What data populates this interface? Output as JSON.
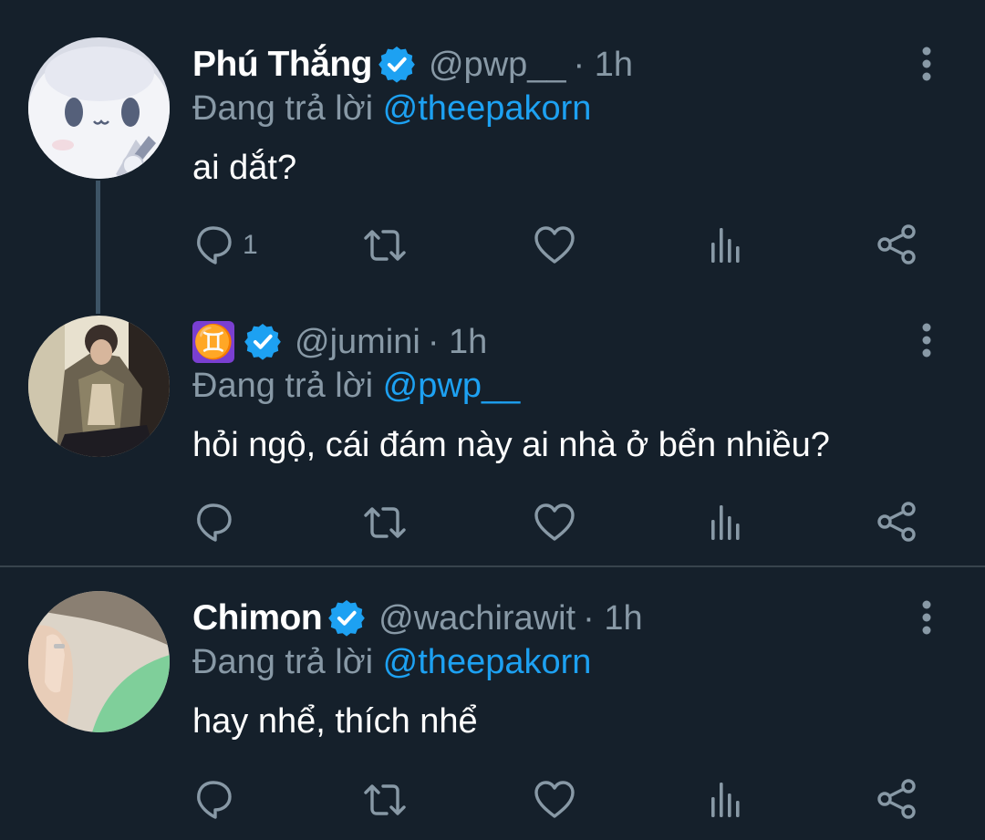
{
  "replying_label": "Đang trả lời",
  "tweets": [
    {
      "name": "Phú Thắng",
      "handle": "@pwp__",
      "time": "· 1h",
      "reply_to": "@theepakorn",
      "text": "ai dắt?",
      "reply_count": "1",
      "avatar_icon": "cartoon-avatar-icon"
    },
    {
      "name": "♊",
      "handle": "@jumini",
      "time": "· 1h",
      "reply_to": "@pwp__",
      "text": "hỏi ngộ, cái đám này ai nhà ở bển nhiều?",
      "reply_count": "",
      "avatar_icon": "photo-avatar-icon"
    },
    {
      "name": "Chimon",
      "handle": "@wachirawit",
      "time": "· 1h",
      "reply_to": "@theepakorn",
      "text": "hay nhể, thích nhể",
      "reply_count": "",
      "avatar_icon": "photo-avatar-icon"
    }
  ],
  "colors": {
    "background": "#15202b",
    "secondary_text": "#8899a6",
    "accent": "#1da1f2",
    "divider": "#38444d"
  },
  "icons": [
    "reply-icon",
    "retweet-icon",
    "like-icon",
    "analytics-icon",
    "share-icon",
    "more-icon",
    "verified-badge-icon"
  ]
}
